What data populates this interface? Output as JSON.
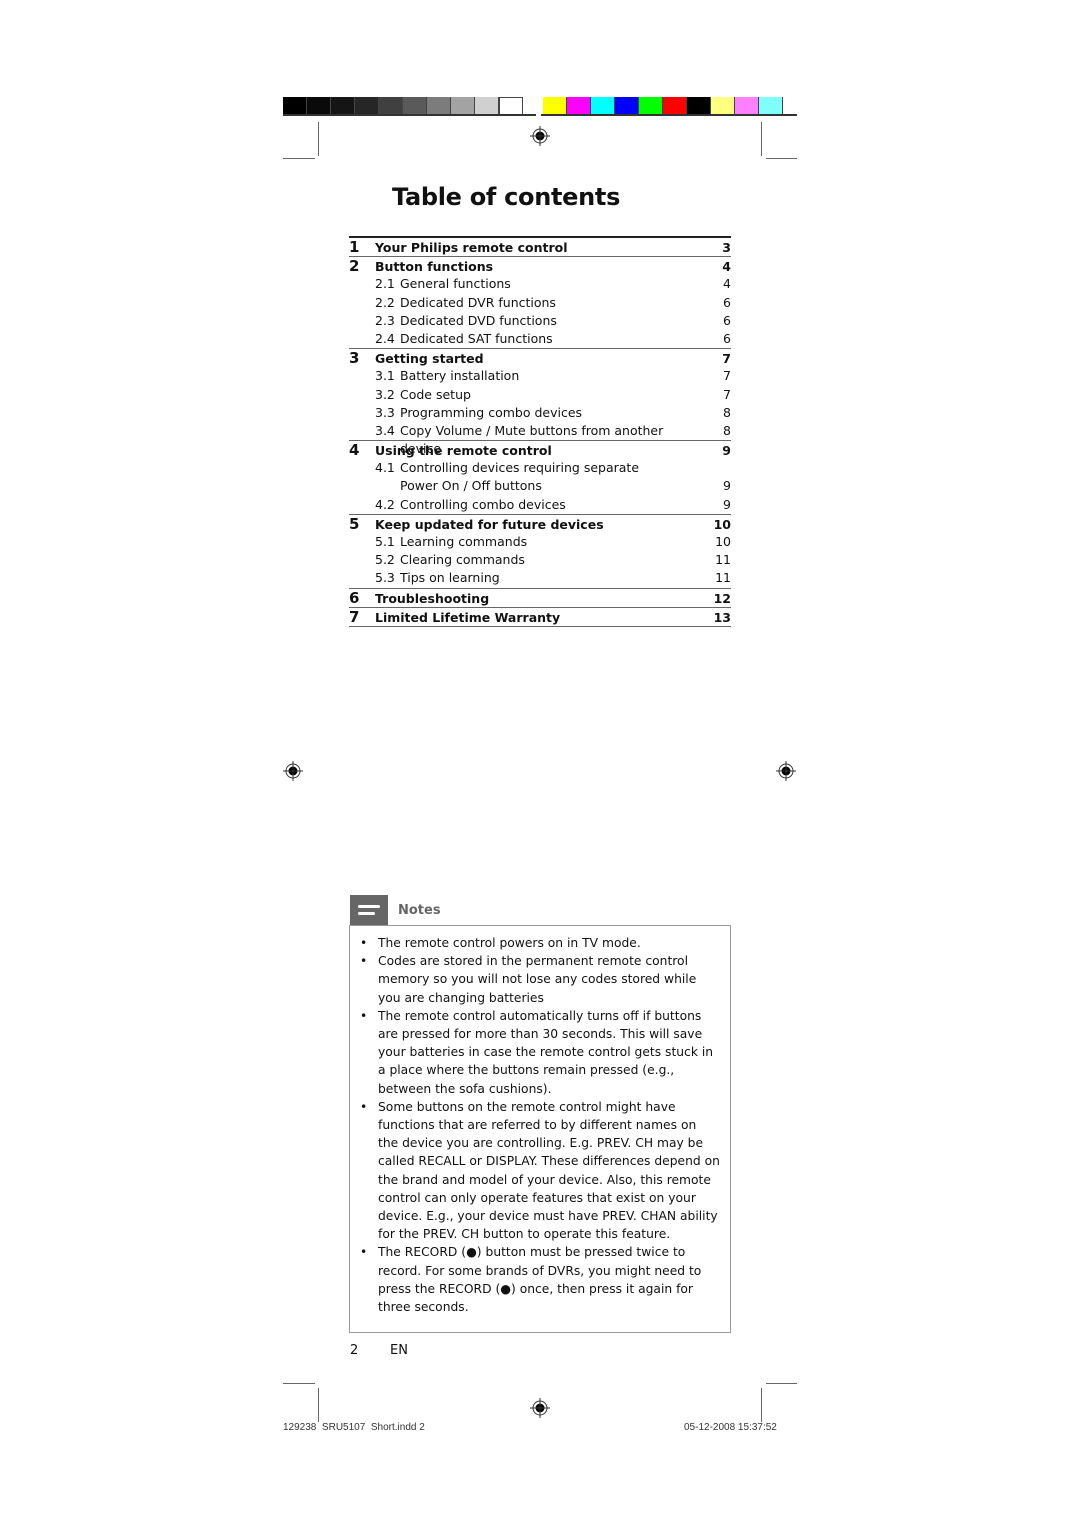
{
  "color_bar": {
    "gray_swatches": [
      "#000000",
      "#0a0a0a",
      "#151515",
      "#262626",
      "#404040",
      "#5a5a5a",
      "#7c7c7c",
      "#a3a3a3",
      "#d0d0d0",
      "#ffffff"
    ],
    "color_swatches": [
      "#ffff00",
      "#ff00ff",
      "#00ffff",
      "#0000ff",
      "#00ff00",
      "#ff0000",
      "#000000",
      "#ffff80",
      "#ff80ff",
      "#80ffff"
    ]
  },
  "page_title": "Table of contents",
  "toc": [
    {
      "num": "1",
      "title": "Your Philips remote control",
      "page": "3",
      "subs": []
    },
    {
      "num": "2",
      "title": "Button functions",
      "page": "4",
      "subs": [
        {
          "num": "2.1",
          "title": "General functions",
          "page": "4"
        },
        {
          "num": "2.2",
          "title": "Dedicated DVR functions",
          "page": "6"
        },
        {
          "num": "2.3",
          "title": "Dedicated DVD functions",
          "page": "6"
        },
        {
          "num": "2.4",
          "title": "Dedicated SAT functions",
          "page": "6"
        }
      ]
    },
    {
      "num": "3",
      "title": "Getting started",
      "page": "7",
      "subs": [
        {
          "num": "3.1",
          "title": "Battery installation",
          "page": "7"
        },
        {
          "num": "3.2",
          "title": "Code setup",
          "page": "7"
        },
        {
          "num": "3.3",
          "title": "Programming combo devices",
          "page": "8"
        },
        {
          "num": "3.4",
          "title": "Copy Volume / Mute buttons from another device",
          "page": "8"
        }
      ]
    },
    {
      "num": "4",
      "title": "Using the remote control",
      "page": "9",
      "subs": [
        {
          "num": "4.1",
          "title": "Controlling devices requiring separate",
          "page": ""
        },
        {
          "num": "",
          "title": "Power On / Off buttons",
          "page": "9"
        },
        {
          "num": "4.2",
          "title": "Controlling combo devices",
          "page": "9"
        }
      ]
    },
    {
      "num": "5",
      "title": "Keep updated for future devices",
      "page": "10",
      "subs": [
        {
          "num": "5.1",
          "title": "Learning commands",
          "page": "10"
        },
        {
          "num": "5.2",
          "title": "Clearing commands",
          "page": "11"
        },
        {
          "num": "5.3",
          "title": "Tips on learning",
          "page": "11"
        }
      ]
    },
    {
      "num": "6",
      "title": "Troubleshooting",
      "page": "12",
      "subs": []
    },
    {
      "num": "7",
      "title": "Limited Lifetime Warranty",
      "page": "13",
      "subs": []
    }
  ],
  "notes": {
    "label": "Notes",
    "icon": "notes-icon",
    "items": [
      "The remote control powers on in TV mode.",
      "Codes are stored in the permanent remote control memory so you will not lose any codes stored while you are changing batteries",
      "The remote control automatically turns off if buttons are pressed for more than 30 seconds. This will save your batteries in case the remote control gets stuck in a place where the buttons remain pressed (e.g., between the sofa cushions).",
      "Some buttons on the remote control might have functions that are referred to by different names on the device you are controlling. E.g. PREV. CH may be called RECALL or DISPLAY. These differences depend on the brand and model of your device.  Also, this remote control can only operate features that exist on your device. E.g., your device must have PREV. CHAN ability for the PREV. CH button to operate this feature.",
      "The RECORD (●) button must be pressed twice to record. For some brands of DVRs, you might need to press the RECORD (●) once, then press it again for three seconds."
    ]
  },
  "footer": {
    "page_number": "2",
    "language": "EN",
    "slug_left": "129238_SRU5107_Short.indd   2",
    "slug_right": "05-12-2008   15:37:52"
  }
}
